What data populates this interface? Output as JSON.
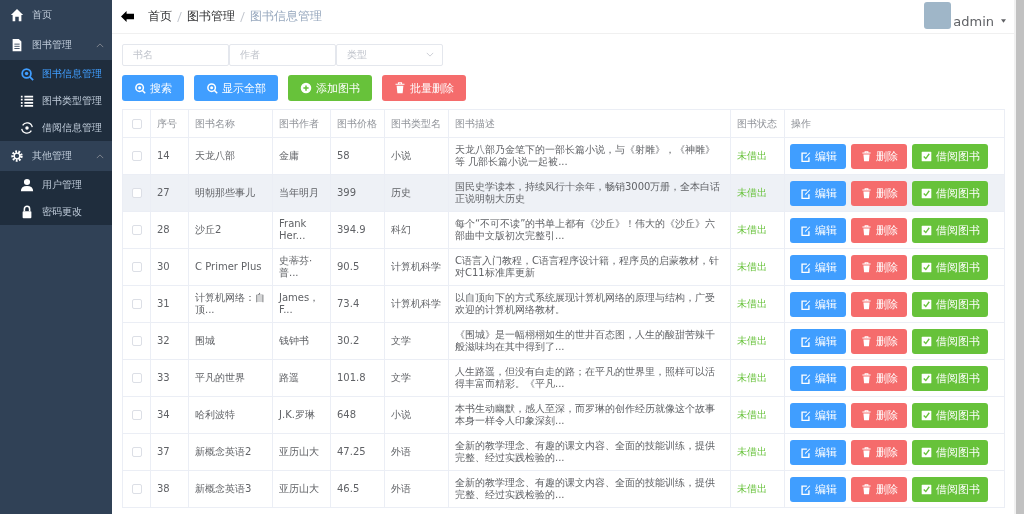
{
  "sidebar": {
    "items": [
      {
        "label": "首页",
        "selected": false
      },
      {
        "label": "图书管理",
        "expanded": true,
        "children": [
          {
            "label": "图书信息管理",
            "selected": true
          },
          {
            "label": "图书类型管理",
            "selected": false
          },
          {
            "label": "借阅信息管理",
            "selected": false
          }
        ]
      },
      {
        "label": "其他管理",
        "expanded": true,
        "children": [
          {
            "label": "用户管理",
            "selected": false
          },
          {
            "label": "密码更改",
            "selected": false
          }
        ]
      }
    ]
  },
  "header": {
    "breadcrumb": [
      "首页",
      "图书管理",
      "图书信息管理"
    ],
    "user": "admin"
  },
  "filters": [
    {
      "placeholder": "书名",
      "kind": "input"
    },
    {
      "placeholder": "作者",
      "kind": "input"
    },
    {
      "placeholder": "类型",
      "kind": "select"
    }
  ],
  "toolbar": [
    {
      "label": "搜索",
      "kind": "search"
    },
    {
      "label": "显示全部",
      "kind": "search"
    },
    {
      "label": "添加图书",
      "kind": "add"
    },
    {
      "label": "批量删除",
      "kind": "delete"
    }
  ],
  "table": {
    "select_all": {
      "checked": false
    },
    "columns": [
      "序号",
      "图书名称",
      "图书作者",
      "图书价格",
      "图书类型名",
      "图书描述",
      "图书状态",
      "操作"
    ],
    "rows": [
      {
        "checked": false,
        "highlighted": false,
        "cells": [
          "14",
          "天龙八部",
          "金庸",
          "58",
          "小说",
          "天龙八部乃金笔下的一部长篇小说，与《射雕》，《神雕》等 几部长篇小说一起被...",
          "未借出"
        ],
        "actions": [
          "编辑",
          "删除",
          "借阅图书"
        ]
      },
      {
        "checked": false,
        "highlighted": true,
        "cells": [
          "27",
          "明朝那些事儿",
          "当年明月",
          "399",
          "历史",
          "国民史学读本，持续风行十余年，畅销3000万册，全本白话正说明朝大历史",
          "未借出"
        ],
        "actions": [
          "编辑",
          "删除",
          "借阅图书"
        ]
      },
      {
        "checked": false,
        "highlighted": false,
        "cells": [
          "28",
          "沙丘2",
          "Frank Her...",
          "394.9",
          "科幻",
          "每个“不可不读”的书单上都有《沙丘》！伟大的《沙丘》六部曲中文版初次完整引...",
          "未借出"
        ],
        "actions": [
          "编辑",
          "删除",
          "借阅图书"
        ]
      },
      {
        "checked": false,
        "highlighted": false,
        "cells": [
          "30",
          "C Primer Plus",
          "史蒂芬·普...",
          "90.5",
          "计算机科学",
          "C语言入门教程，C语言程序设计籍，程序员的启蒙教材，针对C11标准库更新",
          "未借出"
        ],
        "actions": [
          "编辑",
          "删除",
          "借阅图书"
        ]
      },
      {
        "checked": false,
        "highlighted": false,
        "cells": [
          "31",
          "计算机网络：自顶...",
          "James，F...",
          "73.4",
          "计算机科学",
          "以自顶向下的方式系统展现计算机网络的原理与结构，广受欢迎的计算机网络教材。",
          "未借出"
        ],
        "actions": [
          "编辑",
          "删除",
          "借阅图书"
        ]
      },
      {
        "checked": false,
        "highlighted": false,
        "cells": [
          "32",
          "围城",
          "钱钟书",
          "30.2",
          "文学",
          "《围城》是一幅栩栩如生的世井百态图，人生的酸甜苦辣千般滋味均在其中得到了...",
          "未借出"
        ],
        "actions": [
          "编辑",
          "删除",
          "借阅图书"
        ]
      },
      {
        "checked": false,
        "highlighted": false,
        "cells": [
          "33",
          "平凡的世界",
          "路遥",
          "101.8",
          "文学",
          "人生路遥，但没有白走的路；在平凡的世界里，照样可以活得丰富而精彩。《平凡...",
          "未借出"
        ],
        "actions": [
          "编辑",
          "删除",
          "借阅图书"
        ]
      },
      {
        "checked": false,
        "highlighted": false,
        "cells": [
          "34",
          "哈利波特",
          "J.K.罗琳",
          "648",
          "小说",
          "本书生动幽默，感人至深，而罗琳的创作经历就像这个故事本身一样令人印象深刻...",
          "未借出"
        ],
        "actions": [
          "编辑",
          "删除",
          "借阅图书"
        ]
      },
      {
        "checked": false,
        "highlighted": false,
        "cells": [
          "37",
          "新概念英语2",
          "亚历山大",
          "47.25",
          "外语",
          "全新的教学理念、有趣的课文内容、全面的技能训练，提供完整、经过实践检验的...",
          "未借出"
        ],
        "actions": [
          "编辑",
          "删除",
          "借阅图书"
        ]
      },
      {
        "checked": false,
        "highlighted": false,
        "cells": [
          "38",
          "新概念英语3",
          "亚历山大",
          "46.5",
          "外语",
          "全新的教学理念、有趣的课文内容、全面的技能训练，提供完整、经过实践检验的...",
          "未借出"
        ],
        "actions": [
          "编辑",
          "删除",
          "借阅图书"
        ]
      }
    ]
  }
}
